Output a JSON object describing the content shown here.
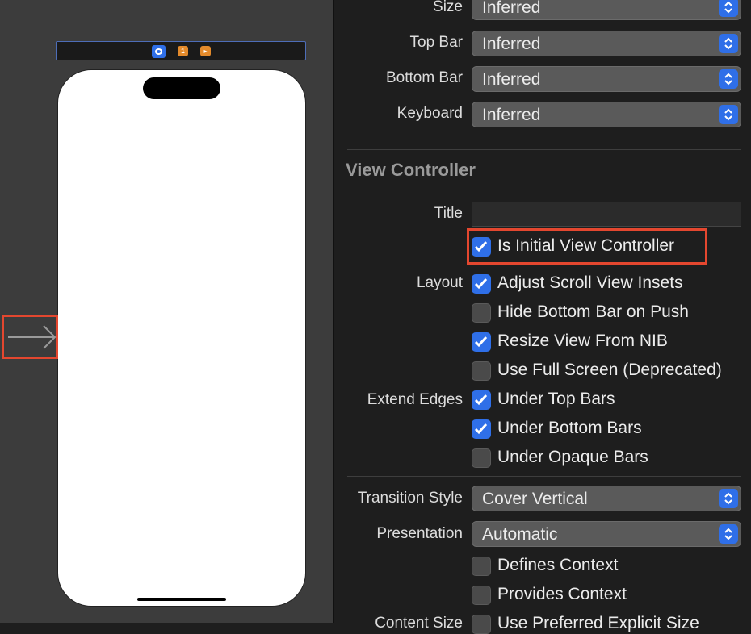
{
  "colors": {
    "accent": "#2f6fe8",
    "highlight": "#e4472f",
    "canvas_bg": "#3c3c3c",
    "inspector_bg": "#1e1e1e"
  },
  "scene_dock": {
    "icons": [
      "view-controller-icon",
      "first-responder-icon",
      "exit-icon"
    ],
    "first_responder_glyph": "1",
    "exit_glyph": "▸"
  },
  "simulated_metrics": {
    "size": {
      "label": "Size",
      "value": "Inferred"
    },
    "top_bar": {
      "label": "Top Bar",
      "value": "Inferred"
    },
    "bottom_bar": {
      "label": "Bottom Bar",
      "value": "Inferred"
    },
    "keyboard": {
      "label": "Keyboard",
      "value": "Inferred"
    }
  },
  "view_controller": {
    "section_title": "View Controller",
    "title_label": "Title",
    "title_value": "",
    "is_initial": {
      "label": "Is Initial View Controller",
      "checked": true
    },
    "layout_label": "Layout",
    "layout_options": [
      {
        "label": "Adjust Scroll View Insets",
        "checked": true
      },
      {
        "label": "Hide Bottom Bar on Push",
        "checked": false
      },
      {
        "label": "Resize View From NIB",
        "checked": true
      },
      {
        "label": "Use Full Screen (Deprecated)",
        "checked": false
      }
    ],
    "extend_edges_label": "Extend Edges",
    "extend_edges_options": [
      {
        "label": "Under Top Bars",
        "checked": true
      },
      {
        "label": "Under Bottom Bars",
        "checked": true
      },
      {
        "label": "Under Opaque Bars",
        "checked": false
      }
    ],
    "transition_style": {
      "label": "Transition Style",
      "value": "Cover Vertical"
    },
    "presentation": {
      "label": "Presentation",
      "value": "Automatic"
    },
    "context_options": [
      {
        "label": "Defines Context",
        "checked": false
      },
      {
        "label": "Provides Context",
        "checked": false
      }
    ],
    "content_size": {
      "label": "Content Size",
      "option_label": "Use Preferred Explicit Size",
      "checked": false
    }
  }
}
